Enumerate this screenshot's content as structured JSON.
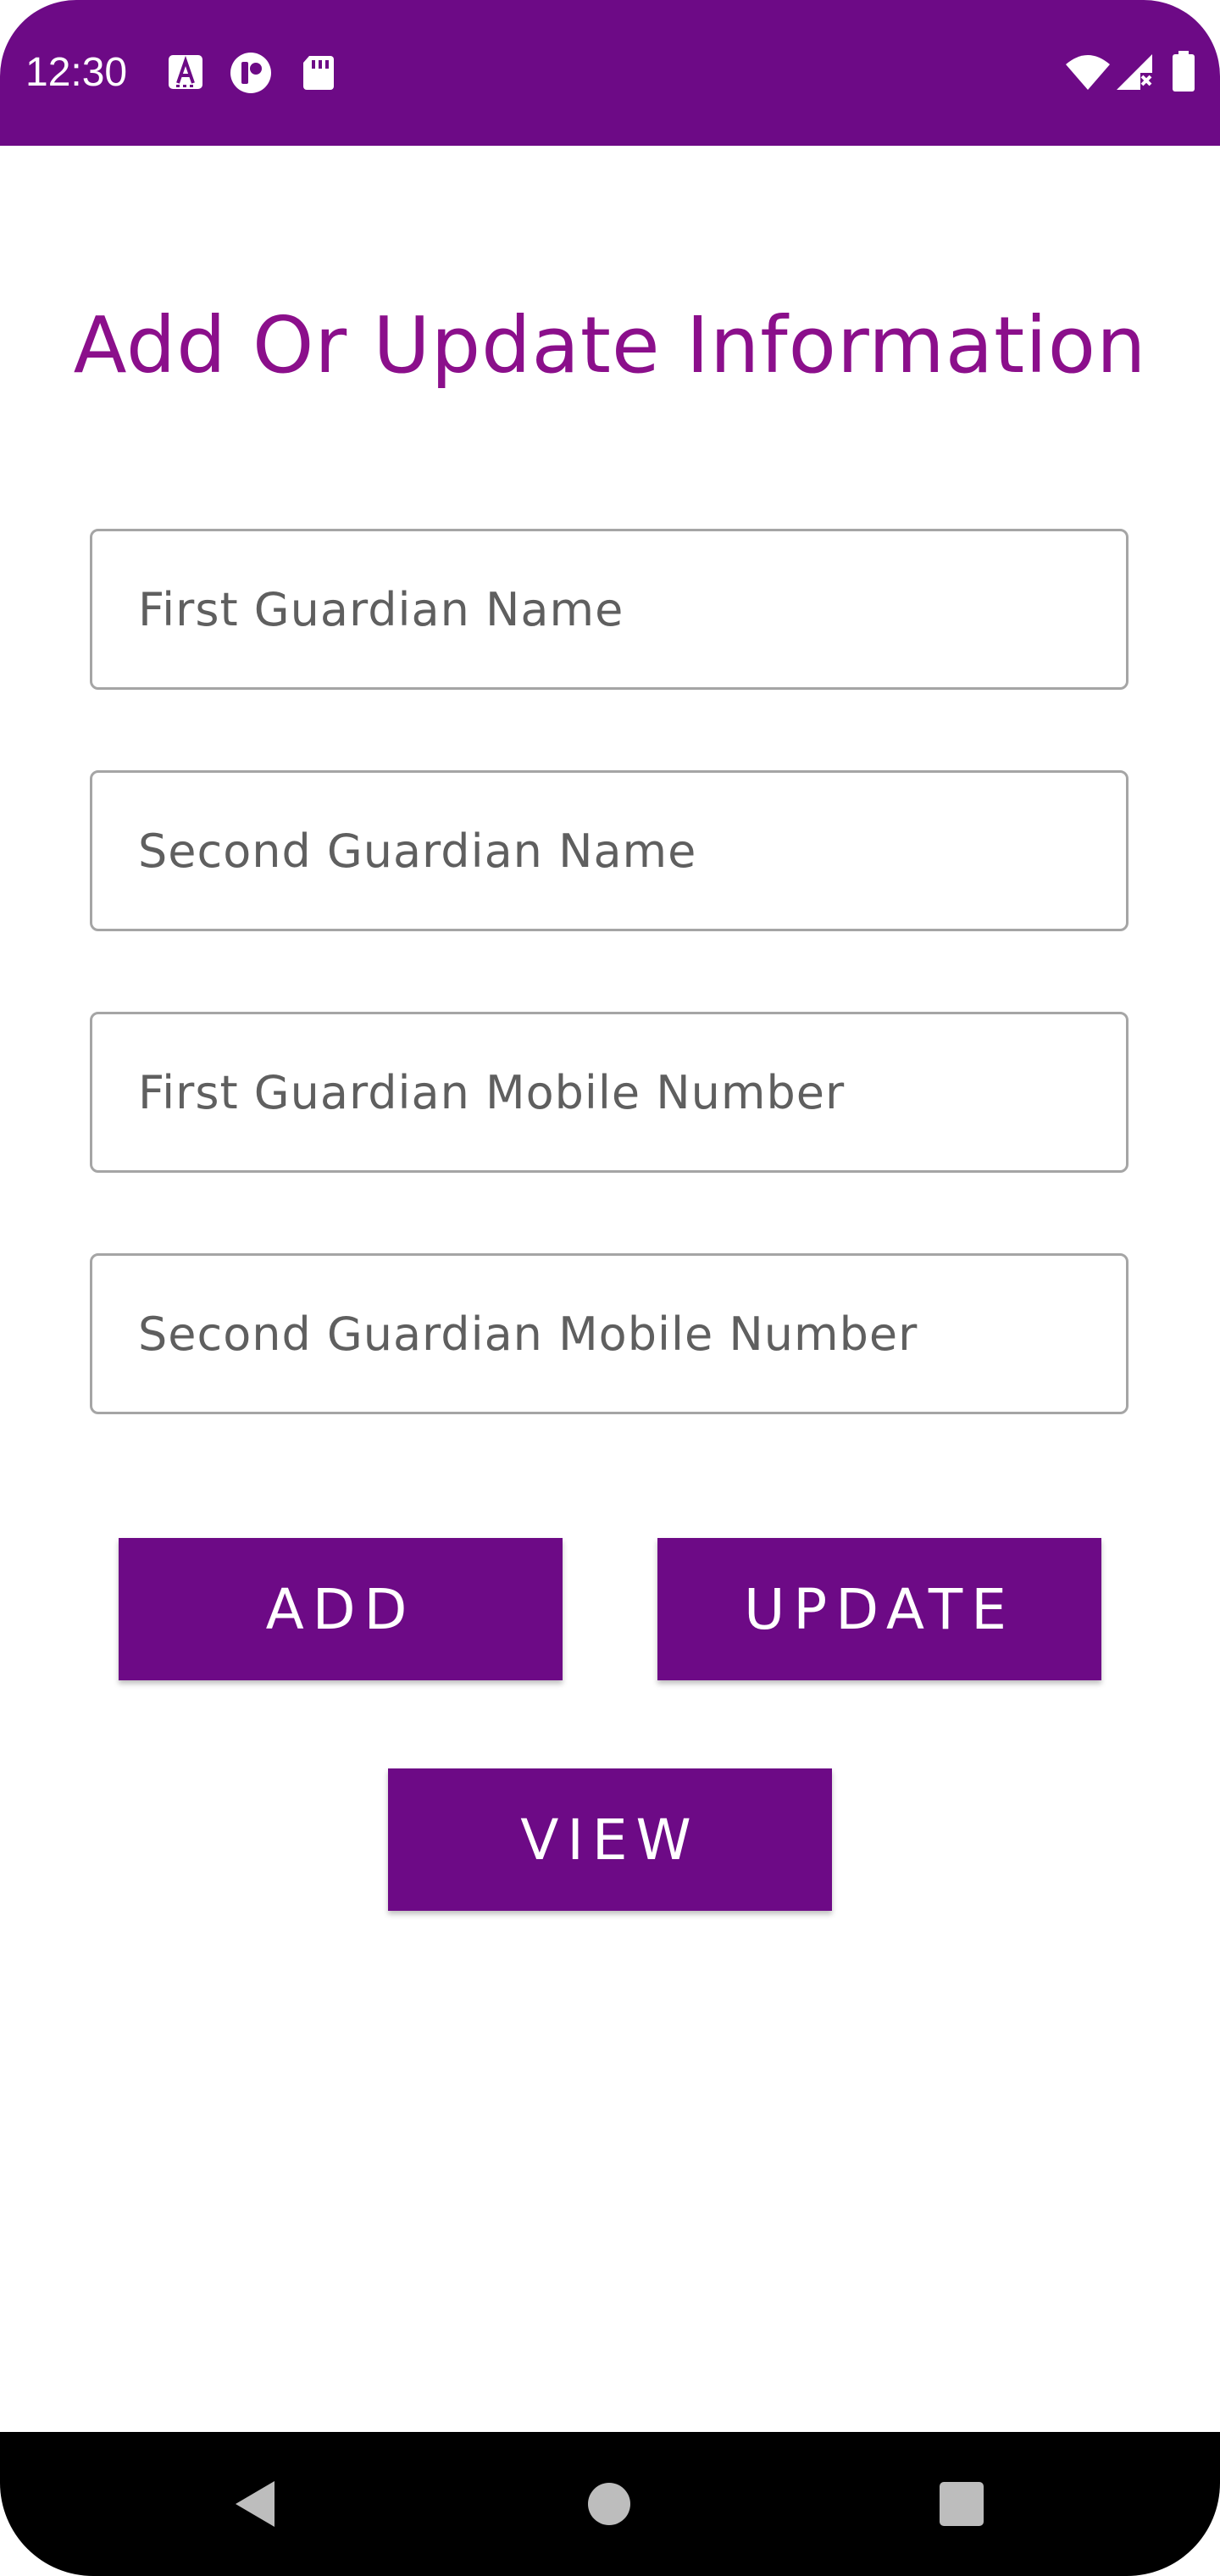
{
  "status_bar": {
    "time": "12:30",
    "left_icons": [
      "font-a-icon",
      "notification-app-icon",
      "sd-card-icon"
    ],
    "right_icons": [
      "wifi-icon",
      "cell-signal-icon",
      "battery-icon"
    ],
    "background": "#6d0a86"
  },
  "form": {
    "title": "Add Or Update Information",
    "title_color": "#8b0f8b",
    "fields": [
      {
        "placeholder": "First Guardian Name",
        "value": ""
      },
      {
        "placeholder": "Second Guardian Name",
        "value": ""
      },
      {
        "placeholder": "First Guardian Mobile Number",
        "value": ""
      },
      {
        "placeholder": "Second Guardian Mobile Number",
        "value": ""
      }
    ],
    "buttons": {
      "add": "ADD",
      "update": "UPDATE",
      "view": "VIEW"
    },
    "accent": "#6d0a86"
  },
  "nav_bar": {
    "icons": [
      "back-icon",
      "home-icon",
      "recents-icon"
    ]
  }
}
